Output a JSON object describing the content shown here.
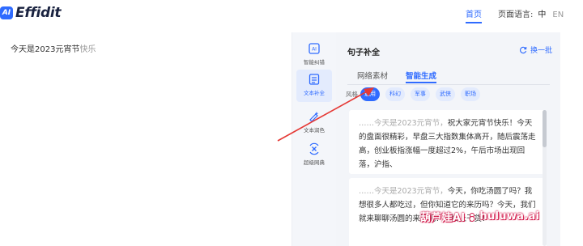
{
  "brand": {
    "logo_mark": "AI",
    "name": "Effidit"
  },
  "nav": {
    "home": "首页",
    "lang_label": "页面语言:",
    "lang_current": "中",
    "lang_alt": "EN"
  },
  "editor": {
    "text_main": "今天是2023元宵节",
    "text_suggest": "快乐"
  },
  "tools": [
    {
      "label": "智能纠错",
      "icon": "ai-correct-icon"
    },
    {
      "label": "文本补全",
      "icon": "text-complete-icon"
    },
    {
      "label": "文本润色",
      "icon": "polish-icon"
    },
    {
      "label": "超级网典",
      "icon": "dictionary-icon"
    }
  ],
  "panel": {
    "title": "句子补全",
    "switch_label": "换一批",
    "tabs": [
      "网络素材",
      "智能生成"
    ],
    "style_label": "风格",
    "styles": [
      "通用",
      "科幻",
      "军事",
      "武侠",
      "职场"
    ],
    "cards": [
      {
        "prefix": "……今天是2023元宵节，",
        "body": "祝大家元宵节快乐！今天的盘面很精彩，早盘三大指数集体高开，随后震荡走高，创业板指涨幅一度超过2%，午后市场出现回落，沪指、"
      },
      {
        "prefix": "……今天是2023元宵节，",
        "body": "今天，你吃汤圆了吗？我想很多人都吃过，但你知道它的来历吗？今天，我们就来聊聊汤圆的来历吧！直接上干货！"
      },
      {
        "prefix": "……",
        "body": ""
      }
    ]
  },
  "watermark": {
    "text_left": "葫芦娃AI",
    "text_right": "huluwa.ai"
  },
  "colors": {
    "accent": "#2f6bff",
    "arrow": "#e53935",
    "panel_bg": "#f3f5f9"
  }
}
